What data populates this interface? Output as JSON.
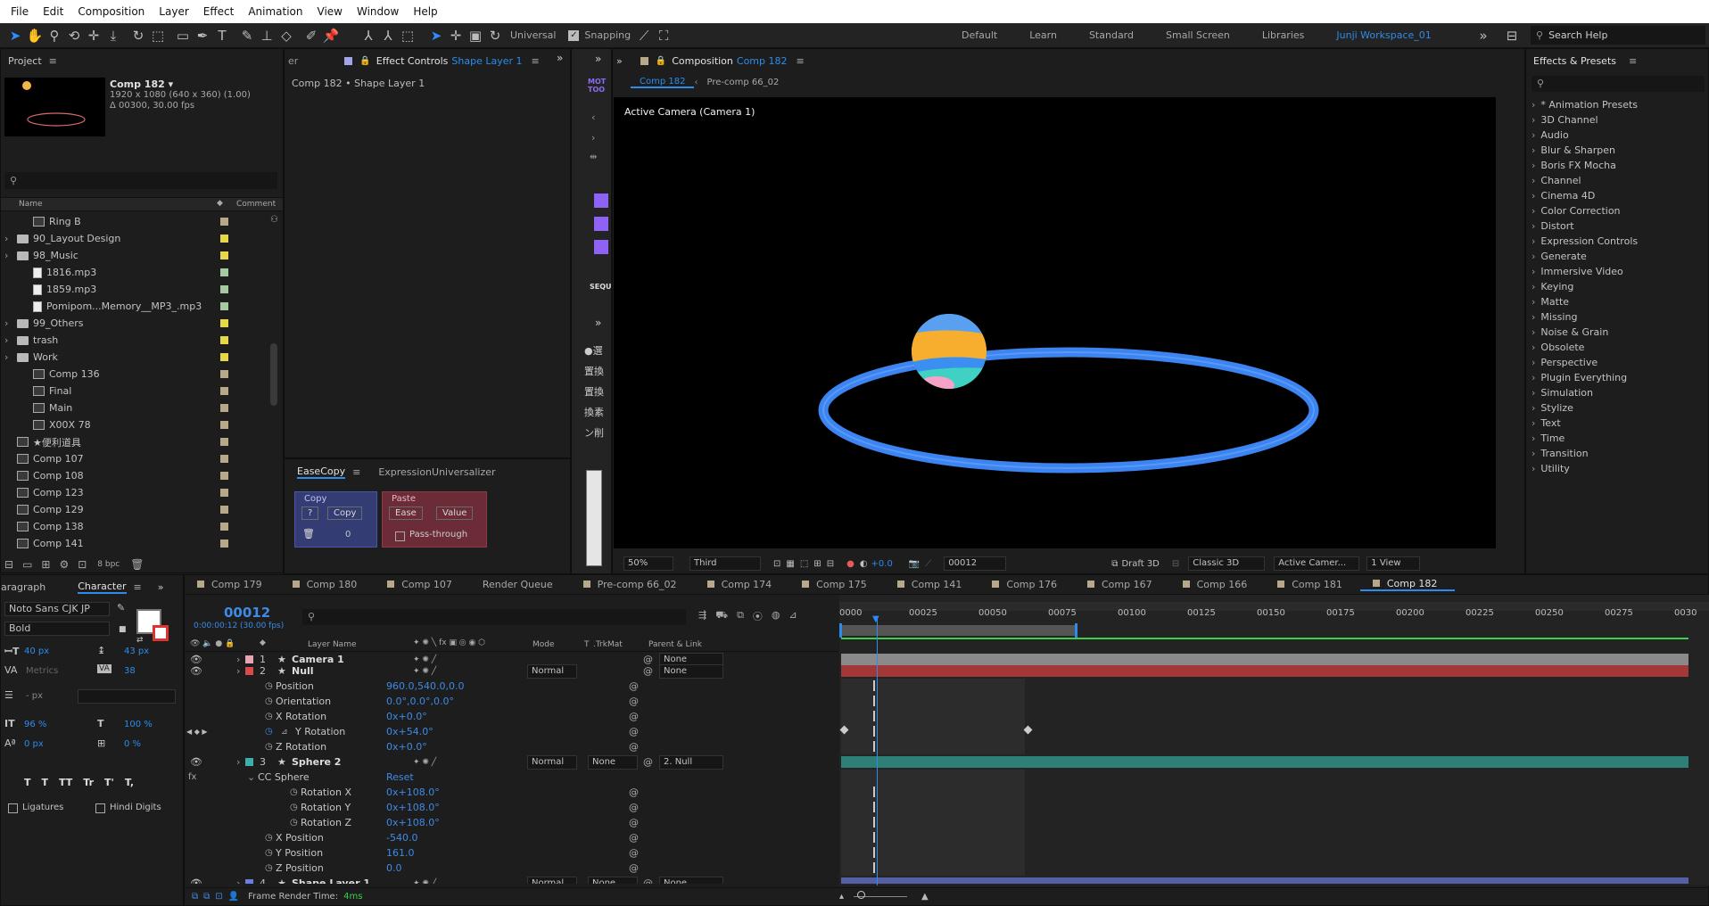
{
  "menu": [
    "File",
    "Edit",
    "Composition",
    "Layer",
    "Effect",
    "Animation",
    "View",
    "Window",
    "Help"
  ],
  "toolbar": {
    "universal": "Universal",
    "snapping": "Snapping",
    "workspaces": [
      "Default",
      "Learn",
      "Standard",
      "Small Screen",
      "Libraries",
      "Junji Workspace_01"
    ],
    "search_placeholder": "Search Help"
  },
  "project": {
    "title": "Project",
    "comp_name": "Comp 182 ▾",
    "comp_res": "1920 x 1080 (640 x 360) (1.00)",
    "comp_dur": "Δ 00300, 30.00 fps",
    "col_name": "Name",
    "col_comment": "Comment",
    "bpc": "8 bpc",
    "items": [
      {
        "name": "Ring B",
        "type": "comp",
        "indent": 2,
        "color": "#b8a88a"
      },
      {
        "name": "90_Layout Design",
        "type": "folder",
        "indent": 1,
        "color": "#e6d84a"
      },
      {
        "name": "98_Music",
        "type": "folder",
        "indent": 1,
        "color": "#e6d84a"
      },
      {
        "name": "1816.mp3",
        "type": "audio",
        "indent": 2,
        "color": "#a7c9a0"
      },
      {
        "name": "1859.mp3",
        "type": "audio",
        "indent": 2,
        "color": "#a7c9a0"
      },
      {
        "name": "Pomipom...Memory__MP3_.mp3",
        "type": "audio",
        "indent": 2,
        "color": "#a7c9a0"
      },
      {
        "name": "99_Others",
        "type": "folder",
        "indent": 1,
        "color": "#e6d84a"
      },
      {
        "name": "trash",
        "type": "folder",
        "indent": 1,
        "color": "#e6d84a"
      },
      {
        "name": "Work",
        "type": "folder",
        "indent": 1,
        "color": "#e6d84a"
      },
      {
        "name": "Comp 136",
        "type": "comp",
        "indent": 2,
        "color": "#b8a88a"
      },
      {
        "name": "Final",
        "type": "comp",
        "indent": 2,
        "color": "#b8a88a"
      },
      {
        "name": "Main",
        "type": "comp",
        "indent": 2,
        "color": "#b8a88a"
      },
      {
        "name": "X00X 78",
        "type": "comp",
        "indent": 2,
        "color": "#b8a88a"
      },
      {
        "name": "★便利道具",
        "type": "comp",
        "indent": 1,
        "color": "#b8a88a"
      },
      {
        "name": "Comp 107",
        "type": "comp",
        "indent": 1,
        "color": "#b8a88a"
      },
      {
        "name": "Comp 108",
        "type": "comp",
        "indent": 1,
        "color": "#b8a88a"
      },
      {
        "name": "Comp 123",
        "type": "comp",
        "indent": 1,
        "color": "#b8a88a"
      },
      {
        "name": "Comp 129",
        "type": "comp",
        "indent": 1,
        "color": "#b8a88a"
      },
      {
        "name": "Comp 138",
        "type": "comp",
        "indent": 1,
        "color": "#b8a88a"
      },
      {
        "name": "Comp 141",
        "type": "comp",
        "indent": 1,
        "color": "#b8a88a"
      }
    ]
  },
  "effect_controls": {
    "tab_prefix": "Effect Controls",
    "tab_layer": "Shape Layer 1",
    "breadcrumb": "Comp 182 • Shape Layer 1",
    "partial_tab": "er"
  },
  "easecopy": {
    "tab1": "EaseCopy",
    "tab2": "ExpressionUniversalizer",
    "copy_title": "Copy",
    "copy_q": "?",
    "copy_btn": "Copy",
    "copy_num": "0",
    "paste_title": "Paste",
    "ease_btn": "Ease",
    "value_btn": "Value",
    "passthrough": "Pass-through"
  },
  "motion": {
    "logo": "MOT TOO",
    "seq": "SEQU",
    "jp": [
      "●選",
      "置換",
      "置換",
      "換素",
      "ン削"
    ]
  },
  "composition": {
    "title_prefix": "Composition",
    "title_comp": "Comp 182",
    "nav1": "Comp 182",
    "nav2": "Pre-comp 66_02",
    "camera_label": "Active Camera (Camera 1)",
    "zoom": "50%",
    "resolution": "Third",
    "exposure": "+0.0",
    "frame": "00012",
    "draft": "Draft 3D",
    "renderer": "Classic 3D",
    "camera": "Active Camer...",
    "views": "1 View"
  },
  "effects_presets": {
    "title": "Effects & Presets",
    "items": [
      "* Animation Presets",
      "3D Channel",
      "Audio",
      "Blur & Sharpen",
      "Boris FX Mocha",
      "Channel",
      "Cinema 4D",
      "Color Correction",
      "Distort",
      "Expression Controls",
      "Generate",
      "Immersive Video",
      "Keying",
      "Matte",
      "Missing",
      "Noise & Grain",
      "Obsolete",
      "Perspective",
      "Plugin Everything",
      "Simulation",
      "Stylize",
      "Text",
      "Time",
      "Transition",
      "Utility"
    ]
  },
  "character": {
    "tab_para": "aragraph",
    "tab_char": "Character",
    "font": "Noto Sans CJK JP",
    "style": "Bold",
    "size": "40 px",
    "leading": "43 px",
    "kerning": "Metrics",
    "tracking": "38",
    "stroke": "- px",
    "vscale": "96 %",
    "hscale": "100 %",
    "baseline": "0 px",
    "tsume": "0 %",
    "ligatures": "Ligatures",
    "hindi": "Hindi Digits",
    "styles": [
      "T",
      "T",
      "TT",
      "Tr",
      "T'",
      "T,"
    ]
  },
  "timeline": {
    "tabs": [
      "Comp 179",
      "Comp 180",
      "Comp 107",
      "Render Queue",
      "Pre-comp 66_02",
      "Comp 174",
      "Comp 175",
      "Comp 141",
      "Comp 176",
      "Comp 167",
      "Comp 166",
      "Comp 181",
      "Comp 182"
    ],
    "timecode": "00012",
    "timecode_sub": "0:00:00:12 (30.00 fps)",
    "headers": {
      "layer_name": "Layer Name",
      "mode": "Mode",
      "t": "T",
      "trkmat": ".TrkMat",
      "parent": "Parent & Link"
    },
    "ruler": [
      "0000",
      "00025",
      "00050",
      "00075",
      "00100",
      "00125",
      "00150",
      "00175",
      "00200",
      "00225",
      "00250",
      "00275",
      "0030"
    ],
    "rows": [
      {
        "kind": "layer",
        "num": "1",
        "name": "Camera 1",
        "color": "#e9a4b4",
        "parent": "None",
        "bar": "#8a8a8a"
      },
      {
        "kind": "layer",
        "num": "2",
        "name": "Null",
        "color": "#d64b4b",
        "mode": "Normal",
        "parent": "None",
        "bar": "#a33838"
      },
      {
        "kind": "prop",
        "name": "Position",
        "value": "960.0,540.0,0.0"
      },
      {
        "kind": "prop",
        "name": "Orientation",
        "value": "0.0°,0.0°,0.0°"
      },
      {
        "kind": "prop",
        "name": "X Rotation",
        "value": "0x+0.0°"
      },
      {
        "kind": "prop",
        "name": "Y Rotation",
        "value": "0x+54.0°",
        "keyed": true
      },
      {
        "kind": "prop",
        "name": "Z Rotation",
        "value": "0x+0.0°"
      },
      {
        "kind": "layer",
        "num": "3",
        "name": "Sphere 2",
        "color": "#3ab0a8",
        "mode": "Normal",
        "trkmat": "None",
        "parent": "2. Null",
        "bar": "#2f7f79"
      },
      {
        "kind": "effect",
        "name": "CC Sphere",
        "value": "Reset"
      },
      {
        "kind": "subprop",
        "name": "Rotation X",
        "value": "0x+108.0°"
      },
      {
        "kind": "subprop",
        "name": "Rotation Y",
        "value": "0x+108.0°"
      },
      {
        "kind": "subprop",
        "name": "Rotation Z",
        "value": "0x+108.0°"
      },
      {
        "kind": "prop",
        "name": "X Position",
        "value": "-540.0"
      },
      {
        "kind": "prop",
        "name": "Y Position",
        "value": "161.0"
      },
      {
        "kind": "prop",
        "name": "Z Position",
        "value": "0.0"
      },
      {
        "kind": "layer",
        "num": "4",
        "name": "Shape Layer 1",
        "color": "#6b7de0",
        "mode": "Normal",
        "trkmat": "None",
        "parent": "None",
        "bar": "#545fa6"
      }
    ],
    "status": "Frame Render Time:",
    "render_time": "4ms"
  },
  "colors": {
    "accent": "#2d8ceb",
    "ring": "#3c84f0"
  }
}
